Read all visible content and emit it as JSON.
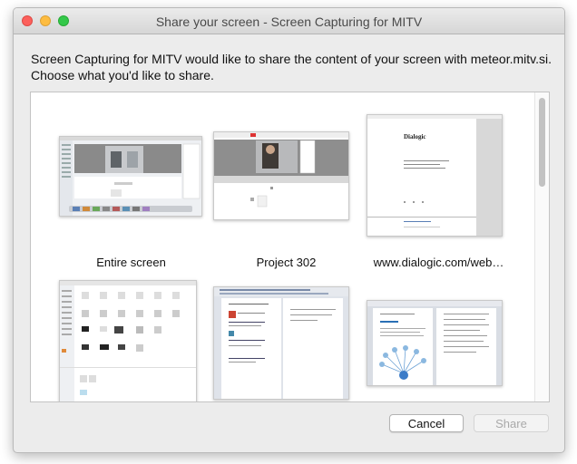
{
  "window": {
    "title": "Share your screen - Screen Capturing for MITV"
  },
  "message": {
    "line1": "Screen Capturing for MITV would like to share the content of your screen with meteor.mitv.si.",
    "line2": "Choose what you'd like to share."
  },
  "sources": [
    {
      "label": "Entire screen"
    },
    {
      "label": "Project 302"
    },
    {
      "label": "www.dialogic.com/web…",
      "page_heading": "Dialogic"
    },
    {
      "label": ""
    },
    {
      "label": ""
    },
    {
      "label": ""
    }
  ],
  "buttons": {
    "cancel": "Cancel",
    "share": "Share"
  },
  "colors": {
    "close": "#fc605c",
    "minimize": "#fdbc40",
    "maximize": "#34c84a",
    "share_disabled_text": "#a9a9a9"
  }
}
